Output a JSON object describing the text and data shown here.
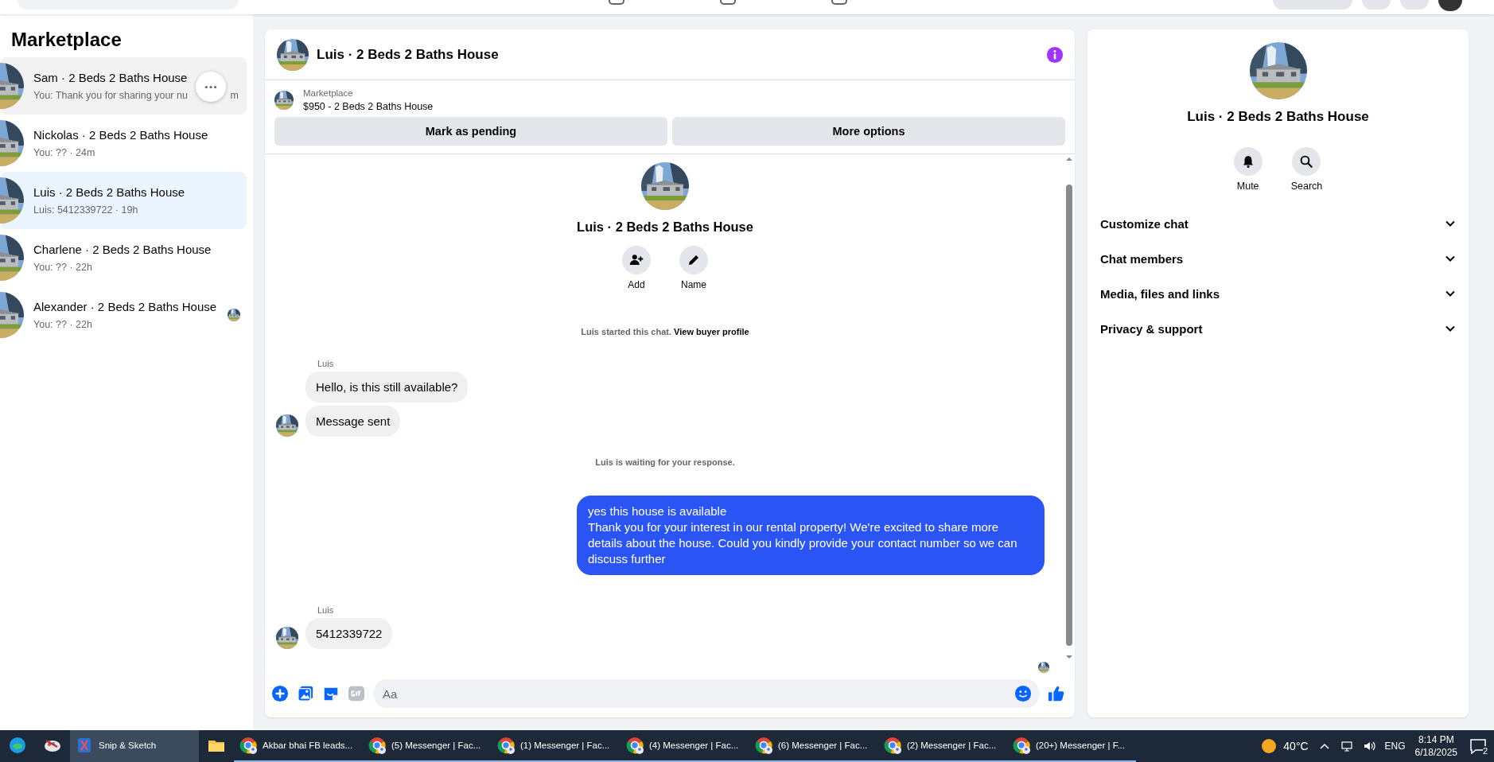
{
  "sidebar": {
    "title": "Marketplace",
    "conversations": [
      {
        "name": "Sam · 2 Beds 2 Baths House",
        "preview": "You: Thank you for sharing your nu",
        "time": "m",
        "selected": false,
        "hovered": true,
        "seen": false
      },
      {
        "name": "Nickolas · 2 Beds 2 Baths House",
        "preview": "You: ?? · 24m",
        "selected": false,
        "hovered": false,
        "seen": false
      },
      {
        "name": "Luis · 2 Beds 2 Baths House",
        "preview": "Luis: 5412339722 · 19h",
        "selected": true,
        "hovered": false,
        "seen": false
      },
      {
        "name": "Charlene · 2 Beds 2 Baths House",
        "preview": "You: ?? · 22h",
        "selected": false,
        "hovered": false,
        "seen": false
      },
      {
        "name": "Alexander · 2 Beds 2 Baths House",
        "preview": "You: ?? · 22h",
        "selected": false,
        "hovered": false,
        "seen": true
      }
    ]
  },
  "chat": {
    "title": "Luis · 2 Beds 2 Baths House",
    "listing": {
      "label": "Marketplace",
      "title": "$950 - 2 Beds 2 Baths House"
    },
    "actions": [
      "Mark as pending",
      "More options"
    ],
    "intro": {
      "name": "Luis · 2 Beds 2 Baths House",
      "actions": [
        {
          "label": "Add",
          "kind": "add"
        },
        {
          "label": "Name",
          "kind": "name"
        }
      ],
      "notice": "Luis started this chat.",
      "link": "View buyer profile"
    },
    "messages": [
      {
        "kind": "sender",
        "text": "Luis"
      },
      {
        "kind": "incoming",
        "text": "Hello, is this still available?",
        "avatar": false
      },
      {
        "kind": "incoming",
        "text": "Message sent",
        "avatar": true
      },
      {
        "kind": "notice",
        "text": "Luis is waiting for your response."
      },
      {
        "kind": "outgoing",
        "lines": [
          "yes this house is available",
          "Thank you for your interest in our rental property! We're excited to share more details about the house. Could you kindly provide your contact number so we can discuss further"
        ]
      },
      {
        "kind": "sender",
        "text": "Luis"
      },
      {
        "kind": "incoming",
        "text": "5412339722",
        "avatar": true
      }
    ],
    "composer": {
      "placeholder": "Aa"
    }
  },
  "details": {
    "name": "Luis · 2 Beds 2 Baths House",
    "actions": [
      {
        "label": "Mute",
        "kind": "mute"
      },
      {
        "label": "Search",
        "kind": "search"
      }
    ],
    "sections": [
      {
        "label": "Customize chat",
        "expanded": false
      },
      {
        "label": "Chat members",
        "expanded": false
      },
      {
        "label": "Media, files and links",
        "expanded": false
      },
      {
        "label": "Privacy & support",
        "expanded": false
      }
    ]
  },
  "taskbar": {
    "apps": [
      {
        "kind": "edge",
        "selected": false
      },
      {
        "kind": "paint",
        "selected": false
      },
      {
        "kind": "snip",
        "label": "Snip & Sketch",
        "selected": true
      },
      {
        "kind": "folder",
        "selected": false
      },
      {
        "kind": "chrome",
        "label": "Akbar bhai FB leads...",
        "selected": false
      },
      {
        "kind": "chrome",
        "label": "(5) Messenger | Fac...",
        "selected": false
      },
      {
        "kind": "chrome",
        "label": "(1) Messenger | Fac...",
        "selected": false
      },
      {
        "kind": "chrome",
        "label": "(4) Messenger | Fac...",
        "selected": false
      },
      {
        "kind": "chrome",
        "label": "(6) Messenger | Fac...",
        "selected": false
      },
      {
        "kind": "chrome",
        "label": "(2) Messenger | Fac...",
        "selected": false
      },
      {
        "kind": "chrome",
        "label": "(20+) Messenger | F...",
        "selected": false
      }
    ],
    "tray": {
      "temperature": "40°C",
      "language": "ENG",
      "time": "8:14 PM",
      "date": "6/18/2025",
      "notifications": "2"
    }
  }
}
